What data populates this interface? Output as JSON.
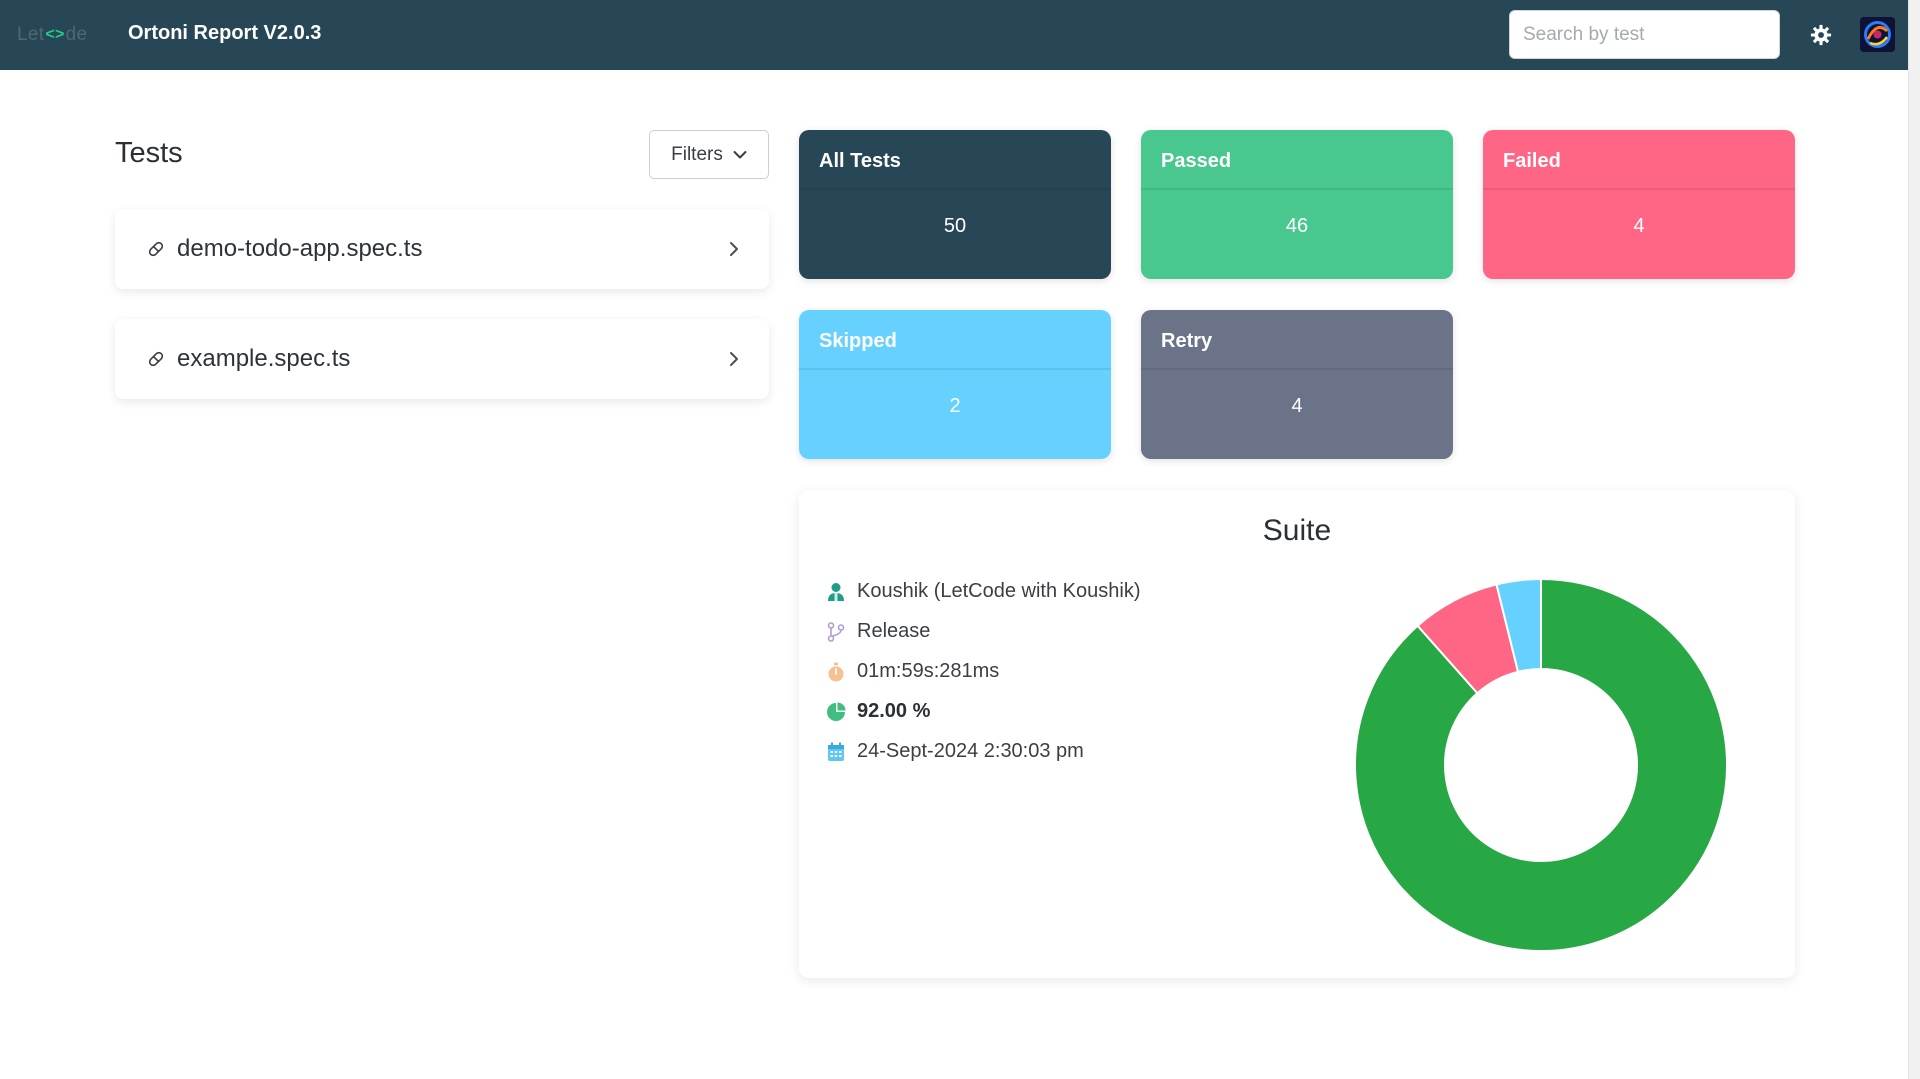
{
  "header": {
    "logo_left": "Let",
    "logo_mark": "<>",
    "logo_right": "de",
    "title": "Ortoni Report V2.0.3",
    "search_placeholder": "Search by test",
    "theme_icon": "gear-icon",
    "avatar_icon": "avatar-icon"
  },
  "tests": {
    "heading": "Tests",
    "filters_label": "Filters",
    "items": [
      {
        "name": "demo-todo-app.spec.ts",
        "icon": "pill-icon"
      },
      {
        "name": "example.spec.ts",
        "icon": "pill-icon"
      }
    ]
  },
  "stats": {
    "all": {
      "label": "All Tests",
      "value": "50",
      "color": "#284756"
    },
    "passed": {
      "label": "Passed",
      "value": "46",
      "color": "#48c78e"
    },
    "failed": {
      "label": "Failed",
      "value": "4",
      "color": "#ff6685"
    },
    "skipped": {
      "label": "Skipped",
      "value": "2",
      "color": "#66d1ff"
    },
    "retry": {
      "label": "Retry",
      "value": "4",
      "color": "#6b7389"
    }
  },
  "suite": {
    "title": "Suite",
    "author": "Koushik (LetCode with Koushik)",
    "type": "Release",
    "duration": "01m:59s:281ms",
    "success_rate": "92.00 %",
    "date": "24-Sept-2024 2:30:03 pm",
    "icons": [
      "user-icon",
      "branch-icon",
      "stopwatch-icon",
      "pie-chart-icon",
      "calendar-icon"
    ]
  },
  "chart_data": {
    "type": "pie",
    "categories": [
      "Passed",
      "Failed",
      "Skipped"
    ],
    "values": [
      46,
      4,
      2
    ],
    "colors": [
      "#28a745",
      "#ff6685",
      "#66d1ff"
    ]
  }
}
